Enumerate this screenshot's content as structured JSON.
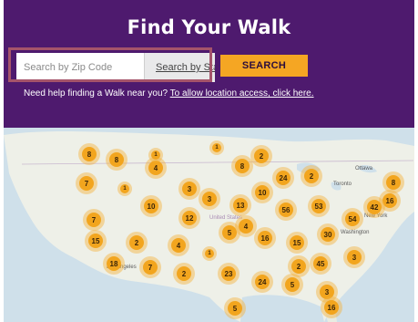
{
  "header": {
    "title": "Find Your Walk",
    "zip_placeholder": "Search by Zip Code",
    "by_state_label": "Search by State",
    "search_button_label": "SEARCH",
    "help_text": "Need help finding a Walk near you? ",
    "help_link_text": "To allow location access, click here."
  },
  "colors": {
    "header_bg": "#4e1a6e",
    "accent": "#f5a623",
    "highlight_border": "#a5546a"
  },
  "map": {
    "place_labels": {
      "ottawa": "Ottawa",
      "toronto": "Toronto",
      "new_york": "New York",
      "washington": "Washington",
      "united_states": "United States",
      "los_angeles": "Los Angeles"
    },
    "clusters": [
      {
        "count": "8"
      },
      {
        "count": "8"
      },
      {
        "count": "4"
      },
      {
        "count": "1"
      },
      {
        "count": "2"
      },
      {
        "count": "1"
      },
      {
        "count": "8"
      },
      {
        "count": "7"
      },
      {
        "count": "1"
      },
      {
        "count": "3"
      },
      {
        "count": "24"
      },
      {
        "count": "2"
      },
      {
        "count": "8"
      },
      {
        "count": "3"
      },
      {
        "count": "10"
      },
      {
        "count": "10"
      },
      {
        "count": "13"
      },
      {
        "count": "56"
      },
      {
        "count": "53"
      },
      {
        "count": "16"
      },
      {
        "count": "7"
      },
      {
        "count": "12"
      },
      {
        "count": "42"
      },
      {
        "count": "54"
      },
      {
        "count": "15"
      },
      {
        "count": "2"
      },
      {
        "count": "4"
      },
      {
        "count": "5"
      },
      {
        "count": "4"
      },
      {
        "count": "16"
      },
      {
        "count": "15"
      },
      {
        "count": "30"
      },
      {
        "count": "1"
      },
      {
        "count": "18"
      },
      {
        "count": "7"
      },
      {
        "count": "2"
      },
      {
        "count": "23"
      },
      {
        "count": "2"
      },
      {
        "count": "45"
      },
      {
        "count": "3"
      },
      {
        "count": "24"
      },
      {
        "count": "5"
      },
      {
        "count": "3"
      },
      {
        "count": "5"
      },
      {
        "count": "16"
      }
    ]
  }
}
